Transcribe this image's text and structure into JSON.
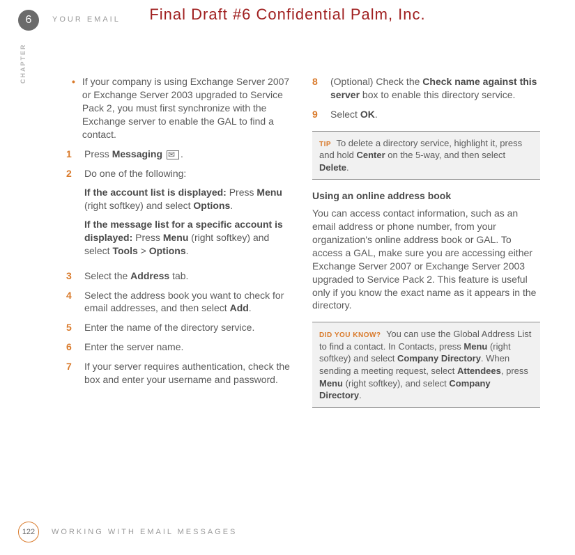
{
  "watermark": "Final Draft #6     Confidential     Palm, Inc.",
  "chapter_number": "6",
  "header_title": "YOUR EMAIL",
  "chapter_side": "CHAPTER",
  "page_number": "122",
  "footer_title": "WORKING WITH EMAIL MESSAGES",
  "left": {
    "bullet": "If your company is using Exchange Server 2007 or Exchange Server 2003 upgraded to Service Pack 2, you must first synchronize with the Exchange server to enable the GAL to find a contact.",
    "s1_pre": "Press ",
    "s1_b": "Messaging",
    "s1_post": " ",
    "s2": "Do one of the following:",
    "s2a_b1": "If the account list is displayed:",
    "s2a_t1": " Press ",
    "s2a_b2": "Menu",
    "s2a_t2": " (right softkey) and select ",
    "s2a_b3": "Options",
    "s2a_t3": ".",
    "s2b_b1": "If the message list for a specific account is displayed:",
    "s2b_t1": " Press ",
    "s2b_b2": "Menu",
    "s2b_t2": " (right softkey) and select ",
    "s2b_b3": "Tools",
    "s2b_t3": " > ",
    "s2b_b4": "Options",
    "s2b_t4": ".",
    "s3_pre": "Select the ",
    "s3_b": "Address",
    "s3_post": " tab.",
    "s4_pre": "Select the address book you want to check for email addresses, and then select ",
    "s4_b": "Add",
    "s4_post": ".",
    "s5": "Enter the name of the directory service.",
    "s6": "Enter the server name.",
    "s7": "If your server requires authentication, check the box and enter your username and password."
  },
  "right": {
    "s8_pre": "(Optional) Check the ",
    "s8_b": "Check name against this server",
    "s8_post": " box to enable this directory service.",
    "s9_pre": "Select ",
    "s9_b": "OK",
    "s9_post": ".",
    "tip_label": "TIP",
    "tip_t1": "To delete a directory service, highlight it, press and hold ",
    "tip_b1": "Center",
    "tip_t2": " on the 5-way, and then select ",
    "tip_b2": "Delete",
    "tip_t3": ".",
    "section_h": "Using an online address book",
    "para": "You can access contact information, such as an email address or phone number, from your organization's online address book or GAL. To access a GAL, make sure you are accessing either Exchange Server 2007 or Exchange Server 2003 upgraded to Service Pack 2. This feature is useful only if you know the exact name as it appears in the directory.",
    "dyk_label": "DID YOU KNOW?",
    "dyk_t1": "You can use the Global Address List to find a contact. In Contacts, press ",
    "dyk_b1": "Menu",
    "dyk_t2": " (right softkey) and select ",
    "dyk_b2": "Company Directory",
    "dyk_t3": ". When sending a meeting request, select ",
    "dyk_b3": "Attendees",
    "dyk_t4": ", press ",
    "dyk_b4": "Menu",
    "dyk_t5": " (right softkey), and select ",
    "dyk_b5": "Company Directory",
    "dyk_t6": "."
  },
  "nums": {
    "n1": "1",
    "n2": "2",
    "n3": "3",
    "n4": "4",
    "n5": "5",
    "n6": "6",
    "n7": "7",
    "n8": "8",
    "n9": "9"
  }
}
